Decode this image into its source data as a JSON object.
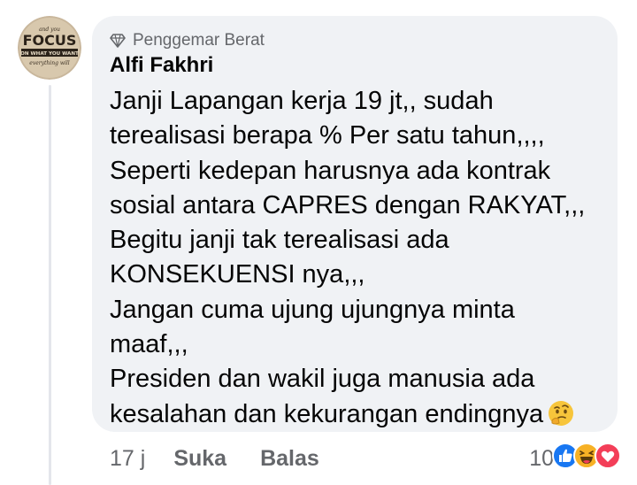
{
  "avatar": {
    "line1": "and you",
    "line2": "FOCUS",
    "line3": "ON WHAT YOU WANT",
    "line4": "everything will"
  },
  "badge": {
    "icon": "diamond-icon",
    "label": "Penggemar Berat"
  },
  "author": "Alfi Fakhri",
  "comment_lines": [
    "Janji Lapangan kerja 19 jt,, sudah",
    "terealisasi berapa % Per satu tahun,,,,",
    "Seperti kedepan harusnya ada kontrak",
    "sosial antara CAPRES dengan RAKYAT,,,",
    "Begitu janji tak terealisasi ada",
    "KONSEKUENSI nya,,,",
    "Jangan cuma ujung ujungnya minta",
    "maaf,,,",
    "Presiden dan wakil juga manusia ada",
    "kesalahan dan kekurangan endingnya"
  ],
  "comment_end_emoji": "thinking-face-icon",
  "footer": {
    "time": "17 j",
    "like": "Suka",
    "reply": "Balas"
  },
  "reactions": {
    "count": "10",
    "icons": [
      "like-reaction-icon",
      "haha-reaction-icon",
      "love-reaction-icon"
    ]
  },
  "colors": {
    "bubble": "#f0f2f5",
    "secondary_text": "#65676b",
    "primary_text": "#050505",
    "like_blue": "#1877f2",
    "love_red": "#f33e58",
    "haha_yellow": "#f7b125"
  }
}
